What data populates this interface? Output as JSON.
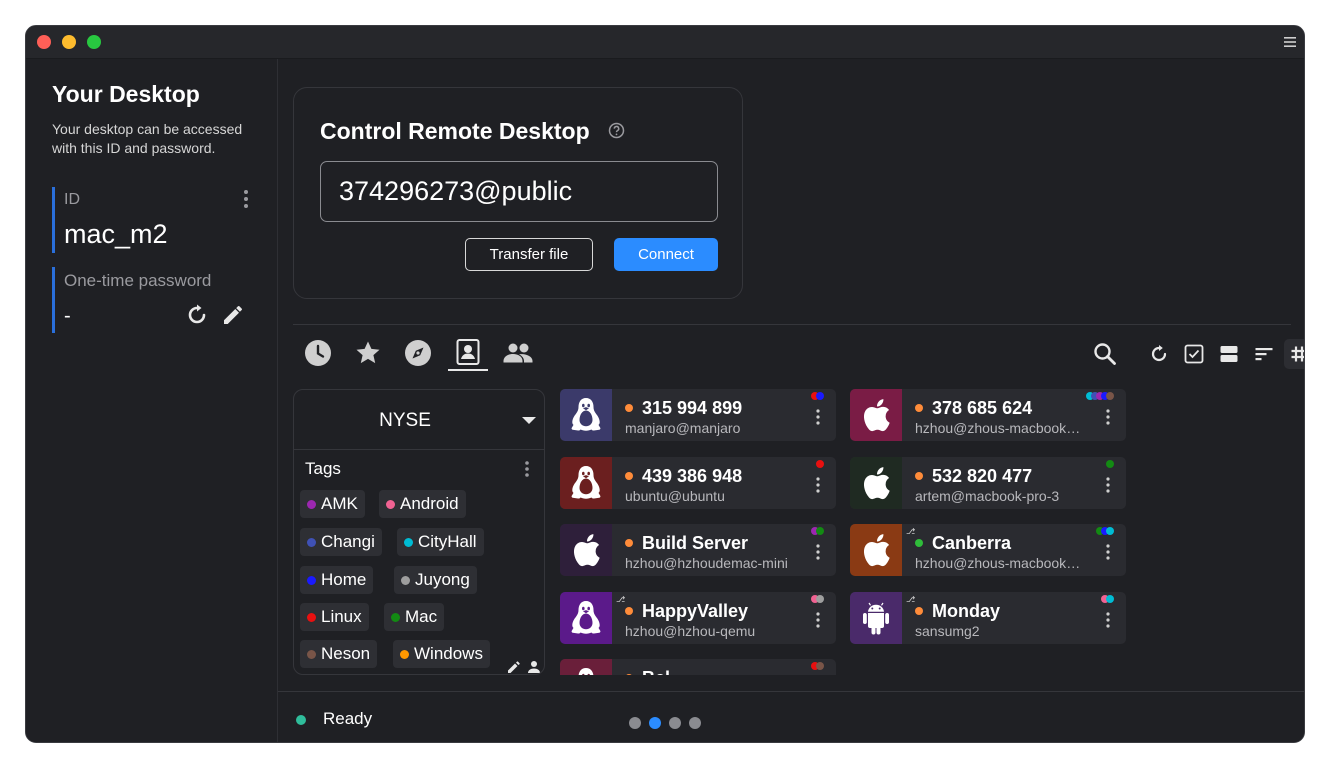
{
  "left": {
    "title": "Your Desktop",
    "description": "Your desktop can be accessed with this ID and password.",
    "id_label": "ID",
    "id_value": "mac_m2",
    "password_label": "One-time password",
    "password_value": "-"
  },
  "control": {
    "title": "Control Remote Desktop",
    "input_value": "374296273@public",
    "transfer_label": "Transfer file",
    "connect_label": "Connect"
  },
  "tabs": [
    "recent-icon",
    "favorites-icon",
    "discovered-icon",
    "address-book-icon",
    "group-icon"
  ],
  "tools": [
    "search-icon",
    "refresh-icon",
    "select-icon",
    "view-icon",
    "sort-icon",
    "grid-icon"
  ],
  "address_book": {
    "name": "NYSE",
    "tags_label": "Tags",
    "tags": [
      {
        "name": "AMK",
        "color": "#9c27b0"
      },
      {
        "name": "Android",
        "color": "#f06292"
      },
      {
        "name": "Changi",
        "color": "#3f51b5"
      },
      {
        "name": "CityHall",
        "color": "#00bcd4"
      },
      {
        "name": "Home",
        "color": "#1a1aff"
      },
      {
        "name": "Juyong",
        "color": "#9e9e9e"
      },
      {
        "name": "Linux",
        "color": "#e81010"
      },
      {
        "name": "Mac",
        "color": "#138a13"
      },
      {
        "name": "Neson",
        "color": "#795548"
      },
      {
        "name": "Windows",
        "color": "#ff9800"
      }
    ]
  },
  "peers": [
    {
      "id": "315 994 899",
      "user": "manjaro@manjaro",
      "os": "linux",
      "bg": "#3b3a6a",
      "status": "#ff8c3a",
      "tags": [
        "#e81010",
        "#1a1aff"
      ],
      "key": false
    },
    {
      "id": "378 685 624",
      "user": "hzhou@zhous-macbook-…",
      "os": "apple",
      "bg": "#7a1c45",
      "status": "#ff8c3a",
      "tags": [
        "#00bcd4",
        "#3f51b5",
        "#9c27b0",
        "#1a1aff",
        "#795548"
      ],
      "key": false
    },
    {
      "id": "439 386 948",
      "user": "ubuntu@ubuntu",
      "os": "linux",
      "bg": "#6b1f1f",
      "status": "#ff8c3a",
      "tags": [
        "#e81010"
      ],
      "key": false
    },
    {
      "id": "532 820 477",
      "user": "artem@macbook-pro-3",
      "os": "apple",
      "bg": "#1f2a22",
      "status": "#ff8c3a",
      "tags": [
        "#138a13"
      ],
      "key": false
    },
    {
      "id": "Build Server",
      "user": "hzhou@hzhoudemac-mini",
      "os": "apple",
      "bg": "#2e1f3a",
      "status": "#ff8c3a",
      "tags": [
        "#9c27b0",
        "#138a13"
      ],
      "key": false
    },
    {
      "id": "Canberra",
      "user": "hzhou@zhous-macbook-…",
      "os": "apple",
      "bg": "#8a3a14",
      "status": "#2fbd3a",
      "tags": [
        "#138a13",
        "#1a1aff",
        "#00bcd4"
      ],
      "key": true
    },
    {
      "id": "HappyValley",
      "user": "hzhou@hzhou-qemu",
      "os": "linux",
      "bg": "#5b1a8a",
      "status": "#ff8c3a",
      "tags": [
        "#f06292",
        "#9e9e9e"
      ],
      "key": true
    },
    {
      "id": "Monday",
      "user": "sansumg2",
      "os": "android",
      "bg": "#4a2a6a",
      "status": "#ff8c3a",
      "tags": [
        "#f06292",
        "#00bcd4"
      ],
      "key": true
    },
    {
      "id": "Bel",
      "user": "",
      "os": "linux",
      "bg": "#6a1f3a",
      "status": "#ff8c3a",
      "tags": [
        "#e81010",
        "#795548"
      ],
      "key": false
    }
  ],
  "status": {
    "text": "Ready"
  },
  "pager": {
    "pages": 4,
    "current": 2
  }
}
